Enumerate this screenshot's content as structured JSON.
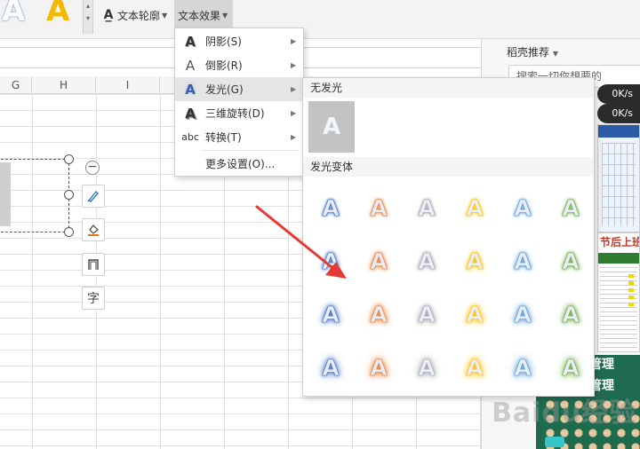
{
  "toolbar": {
    "art_preset_1": "A",
    "art_preset_2": "A",
    "text_outline_label": "文本轮廓",
    "text_effect_label": "文本效果"
  },
  "columns": [
    "G",
    "H",
    "I"
  ],
  "effects_menu": {
    "items": [
      {
        "icon": "A",
        "label": "阴影(S)"
      },
      {
        "icon": "A",
        "label": "倒影(R)"
      },
      {
        "icon": "A",
        "label": "发光(G)"
      },
      {
        "icon": "A",
        "label": "三维旋转(D)"
      },
      {
        "icon": "abc",
        "label": "转换(T)"
      }
    ],
    "more_settings": "更多设置(O)..."
  },
  "glow_submenu": {
    "no_glow_header": "无发光",
    "no_glow_letter": "A",
    "variants_header": "发光变体",
    "variant_letter": "A",
    "glow_colors": [
      "#4472c4",
      "#ed7d31",
      "#a5a5a5",
      "#ffc000",
      "#5b9bd5",
      "#70ad47"
    ],
    "glow_sizes": [
      1,
      2,
      3,
      4
    ]
  },
  "float_tools": {
    "text_tool_label": "字"
  },
  "right_pane": {
    "title": "稻壳推荐",
    "search_text": "搜索一切你想要的"
  },
  "net_speed": {
    "upload": "0K/s",
    "download": "0K/s"
  },
  "templates": {
    "t2_title": "节后上班人",
    "t3_title_a": "料管理",
    "t3_title_b": "料管理"
  },
  "watermark": "Baidu经验"
}
